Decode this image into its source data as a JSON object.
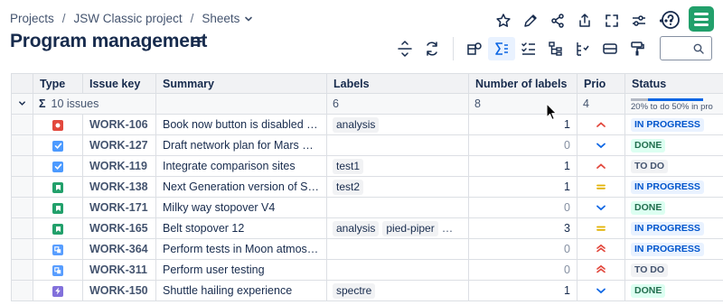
{
  "breadcrumb": {
    "items": [
      "Projects",
      "JSW Classic project",
      "Sheets"
    ],
    "separator": "/"
  },
  "page": {
    "title": "Program management"
  },
  "table": {
    "columns": [
      "Type",
      "Issue key",
      "Summary",
      "Labels",
      "Number of labels",
      "Prio",
      "Status"
    ],
    "summary": {
      "issues": "10 issues",
      "labels": "6",
      "number_of_labels": "8",
      "prio": "4",
      "status_text": "20% to do   50% in pro",
      "status_todo_fraction": 0.2,
      "status_in_progress_fraction": 0.5
    },
    "rows": [
      {
        "type": "bug",
        "key": "WORK-106",
        "summary": "Book now button is disabled / un…",
        "labels": [
          "analysis"
        ],
        "more": "",
        "count": "1",
        "prio": "high",
        "status": "IN PROGRESS",
        "status_kind": "progress"
      },
      {
        "type": "task",
        "key": "WORK-127",
        "summary": "Draft network plan for Mars Office",
        "labels": [],
        "more": "",
        "count": "0",
        "prio": "low",
        "status": "DONE",
        "status_kind": "done"
      },
      {
        "type": "task",
        "key": "WORK-119",
        "summary": "Integrate comparison sites",
        "labels": [
          "test1"
        ],
        "more": "",
        "count": "1",
        "prio": "high",
        "status": "TO DO",
        "status_kind": "todo"
      },
      {
        "type": "story",
        "key": "WORK-138",
        "summary": "Next Generation version of SeeS…",
        "labels": [
          "test2"
        ],
        "more": "",
        "count": "1",
        "prio": "medium",
        "status": "IN PROGRESS",
        "status_kind": "progress"
      },
      {
        "type": "story",
        "key": "WORK-171",
        "summary": "Milky way stopover V4",
        "labels": [],
        "more": "",
        "count": "0",
        "prio": "low",
        "status": "DONE",
        "status_kind": "done"
      },
      {
        "type": "story",
        "key": "WORK-165",
        "summary": "Belt stopover 12",
        "labels": [
          "analysis",
          "pied-piper"
        ],
        "more": "…",
        "count": "3",
        "prio": "medium",
        "status": "IN PROGRESS",
        "status_kind": "progress"
      },
      {
        "type": "subtask",
        "key": "WORK-364",
        "summary": "Perform tests in Moon atmosphere",
        "labels": [],
        "more": "",
        "count": "0",
        "prio": "highest",
        "status": "IN PROGRESS",
        "status_kind": "progress"
      },
      {
        "type": "subtask",
        "key": "WORK-311",
        "summary": "Perform user testing",
        "labels": [],
        "more": "",
        "count": "0",
        "prio": "highest",
        "status": "TO DO",
        "status_kind": "todo"
      },
      {
        "type": "epic",
        "key": "WORK-150",
        "summary": "Shuttle hailing experience",
        "labels": [
          "spectre"
        ],
        "more": "",
        "count": "1",
        "prio": "low",
        "status": "DONE",
        "status_kind": "done"
      }
    ]
  },
  "colors": {
    "accent": "#0c66e4",
    "prio_high": "#e2483d",
    "prio_medium": "#e2b203",
    "prio_low": "#0c66e4",
    "app_logo": "#22a06b"
  }
}
